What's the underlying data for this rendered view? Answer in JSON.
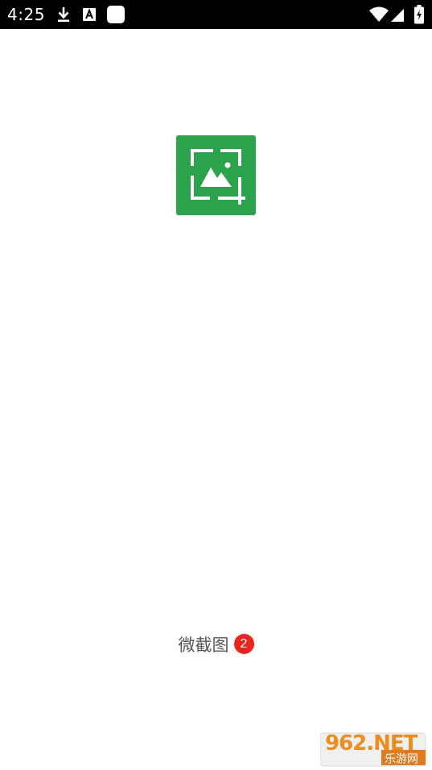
{
  "status_bar": {
    "time": "4:25",
    "icons": [
      "download-icon",
      "font-a-icon",
      "app-notification-icon",
      "wifi-icon",
      "cellular-signal-icon",
      "battery-icon"
    ]
  },
  "splash": {
    "logo_icon": "screenshot-crop-image-icon",
    "logo_color": "#2ba24c",
    "app_name": "微截图",
    "badge_count": "2",
    "badge_color": "#e8261d"
  },
  "watermark": {
    "logo_text": "962.NET",
    "sub_text": "乐游网"
  }
}
